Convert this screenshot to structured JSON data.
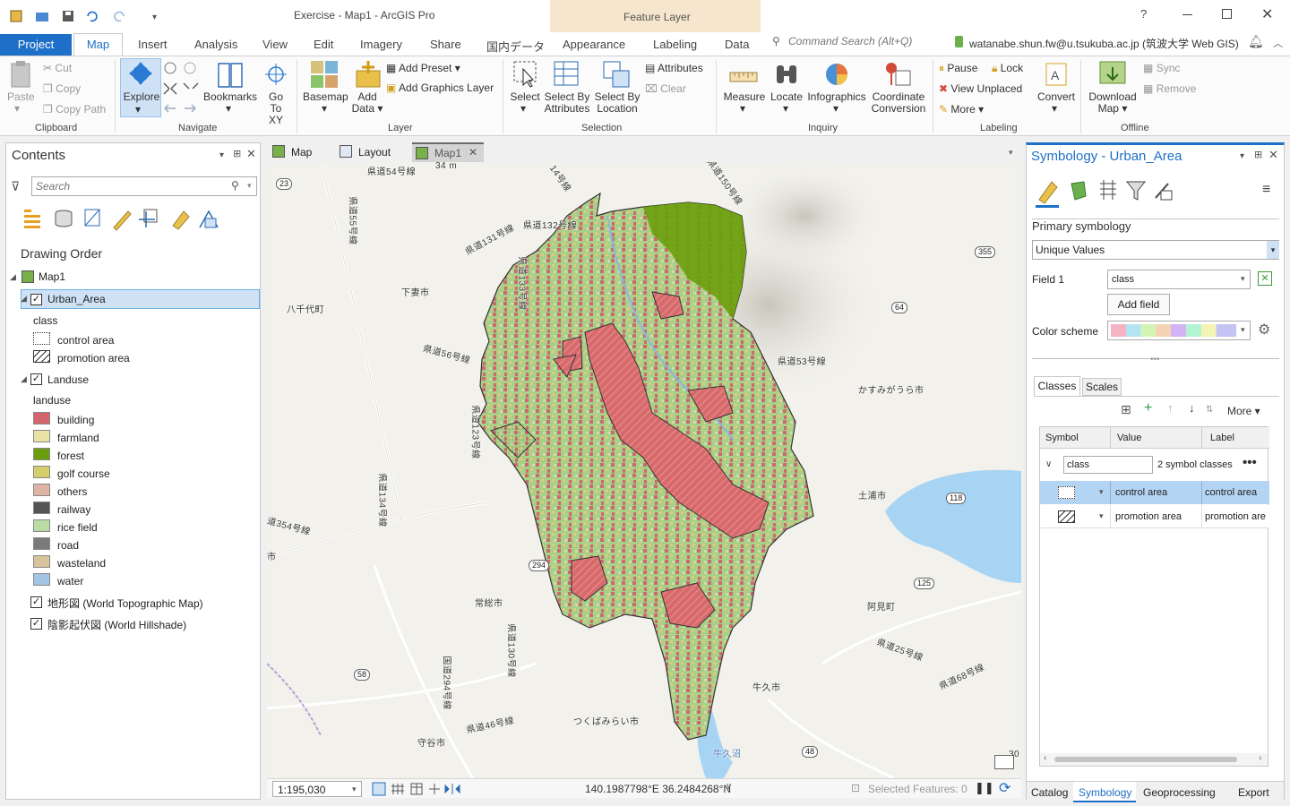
{
  "titlebar": {
    "title": "Exercise - Map1 - ArcGIS Pro",
    "context_tab": "Feature Layer",
    "help": "?"
  },
  "tabs": {
    "project": "Project",
    "map": "Map",
    "insert": "Insert",
    "analysis": "Analysis",
    "view": "View",
    "edit": "Edit",
    "imagery": "Imagery",
    "share": "Share",
    "jp_data": "国内データ",
    "appearance": "Appearance",
    "labeling": "Labeling",
    "data": "Data"
  },
  "search": {
    "placeholder": "Command Search (Alt+Q)"
  },
  "account": {
    "user": "watanabe.shun.fw@u.tsukuba.ac.jp (筑波大学 Web GIS)"
  },
  "ribbon": {
    "clipboard": {
      "paste": "Paste",
      "cut": "Cut",
      "copy": "Copy",
      "copy_path": "Copy Path",
      "label": "Clipboard"
    },
    "navigate": {
      "explore": "Explore",
      "bookmarks": "Bookmarks",
      "goto1": "Go",
      "goto2": "To XY",
      "label": "Navigate"
    },
    "layer": {
      "basemap": "Basemap",
      "add_data1": "Add",
      "add_data2": "Data",
      "add_preset": "Add Preset",
      "add_graphics": "Add Graphics Layer",
      "label": "Layer"
    },
    "selection": {
      "select": "Select",
      "sba1": "Select By",
      "sba2": "Attributes",
      "sbl1": "Select By",
      "sbl2": "Location",
      "attributes": "Attributes",
      "clear": "Clear",
      "label": "Selection"
    },
    "inquiry": {
      "measure": "Measure",
      "locate": "Locate",
      "infographics": "Infographics",
      "coord1": "Coordinate",
      "coord2": "Conversion",
      "label": "Inquiry"
    },
    "labeling": {
      "pause": "Pause",
      "lock": "Lock",
      "view_unplaced": "View Unplaced",
      "more": "More",
      "convert": "Convert",
      "label": "Labeling"
    },
    "offline": {
      "dl1": "Download",
      "dl2": "Map",
      "sync": "Sync",
      "remove": "Remove",
      "label": "Offline"
    }
  },
  "contents": {
    "title": "Contents",
    "search_placeholder": "Search",
    "drawing_order": "Drawing Order",
    "map_name": "Map1",
    "urban_layer": "Urban_Area",
    "urban_field": "class",
    "urban_classes": [
      {
        "label": "control area",
        "pattern": "dots"
      },
      {
        "label": "promotion area",
        "pattern": "hatch"
      }
    ],
    "landuse_layer": "Landuse",
    "landuse_field": "landuse",
    "landuse_classes": [
      {
        "label": "building",
        "color": "#d4656c"
      },
      {
        "label": "farmland",
        "color": "#e8e3a4"
      },
      {
        "label": "forest",
        "color": "#6a9e0c"
      },
      {
        "label": "golf course",
        "color": "#d4ce6a"
      },
      {
        "label": "others",
        "color": "#e0b4a4"
      },
      {
        "label": "railway",
        "color": "#555555"
      },
      {
        "label": "rice field",
        "color": "#b8dca4"
      },
      {
        "label": "road",
        "color": "#7a7a7a"
      },
      {
        "label": "wasteland",
        "color": "#d8c49c"
      },
      {
        "label": "water",
        "color": "#a4c4e4"
      }
    ],
    "basemap_topo": "地形図 (World Topographic Map)",
    "basemap_hillshade": "陰影起伏図 (World Hillshade)"
  },
  "view_tabs": {
    "map": "Map",
    "layout": "Layout",
    "map1": "Map1"
  },
  "map_labels": {
    "r54": "県道54号線",
    "alt": "34 m",
    "r14": "14号線",
    "r150": "県道150号線",
    "r23": "23",
    "r131": "県道131号線",
    "r132": "県道132号線",
    "r55": "県道55号線",
    "shimotsuma": "下妻市",
    "yachiyo": "八千代町",
    "r133": "県道133号線",
    "r56": "県道56号線",
    "r53": "県道53号線",
    "s355": "355",
    "s64": "64",
    "kasumigaura": "かすみがうら市",
    "r123": "県道123号線",
    "r134": "県道134号線",
    "r354": "道354号線",
    "tsuchiura": "土浦市",
    "s118": "118",
    "joso": "常総市",
    "s125": "125",
    "ami": "阿見町",
    "r130": "県道130号線",
    "r25": "県道25号線",
    "r68": "県道68号線",
    "ushiku": "牛久市",
    "r294": "国道294号線",
    "s58": "58",
    "tsukubamirai": "つくばみらい市",
    "r46": "県道46号線",
    "moriya": "守谷市",
    "ushikunuma": "牛久沼",
    "s48": "48",
    "shi": "市",
    "s294b": "294",
    "s30": "30"
  },
  "status": {
    "scale": "1:195,030",
    "coords": "140.1987798°E 36.2484268°N",
    "selected": "Selected Features: 0"
  },
  "symbology": {
    "title": "Symbology - Urban_Area",
    "primary": "Primary symbology",
    "method": "Unique Values",
    "field_label": "Field 1",
    "field_value": "class",
    "add_field": "Add field",
    "color_scheme": "Color scheme",
    "tab_classes": "Classes",
    "tab_scales": "Scales",
    "more": "More",
    "col_symbol": "Symbol",
    "col_value": "Value",
    "col_label": "Label",
    "group_field": "class",
    "group_count": "2 symbol classes",
    "rows": [
      {
        "value": "control area",
        "label": "control area"
      },
      {
        "value": "promotion area",
        "label": "promotion are"
      }
    ]
  },
  "bottom_tabs": {
    "catalog": "Catalog",
    "symbology": "Symbology",
    "geoprocessing": "Geoprocessing",
    "export": "Export"
  }
}
